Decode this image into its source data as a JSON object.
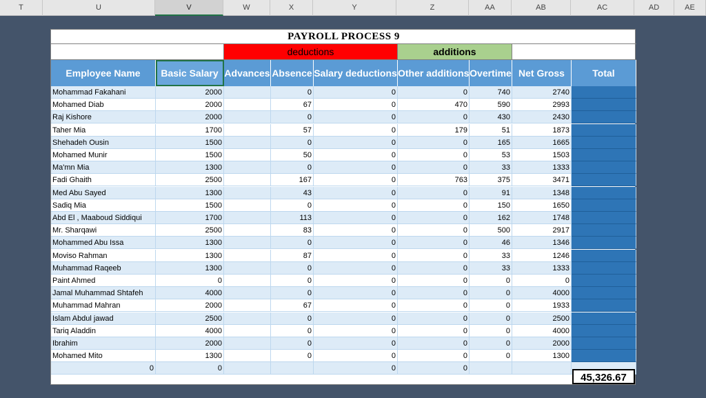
{
  "column_headers": [
    "T",
    "U",
    "V",
    "W",
    "X",
    "Y",
    "Z",
    "AA",
    "AB",
    "AC",
    "AD",
    "AE"
  ],
  "title": "PAYROLL PROCESS  9",
  "bands": {
    "deductions": "deductions",
    "additions": "additions"
  },
  "colors": {
    "deductions_band": "#ff0000",
    "additions_band": "#a9d08e",
    "header_fill": "#5b9bd5",
    "total_fill": "#2e75b6",
    "zebra": "#ddebf7",
    "background": "#44546a"
  },
  "headers": [
    "Employee Name",
    "Basic Salary",
    "Advances",
    "Absence",
    "Salary deductions",
    "Other additions",
    "Overtime",
    "Net Gross",
    "Total"
  ],
  "rows": [
    [
      "Mohammad Fakahani",
      "2000",
      "",
      "0",
      "0",
      "0",
      "740",
      "2740"
    ],
    [
      "Mohamed Diab",
      "2000",
      "",
      "67",
      "0",
      "470",
      "590",
      "2993"
    ],
    [
      "Raj Kishore",
      "2000",
      "",
      "0",
      "0",
      "0",
      "430",
      "2430"
    ],
    [
      "Taher Mia",
      "1700",
      "",
      "57",
      "0",
      "179",
      "51",
      "1873"
    ],
    [
      "Shehadeh Ousin",
      "1500",
      "",
      "0",
      "0",
      "0",
      "165",
      "1665"
    ],
    [
      "Mohamed Munir",
      "1500",
      "",
      "50",
      "0",
      "0",
      "53",
      "1503"
    ],
    [
      "Ma'mn Mia",
      "1300",
      "",
      "0",
      "0",
      "0",
      "33",
      "1333"
    ],
    [
      "Fadi Ghaith",
      "2500",
      "",
      "167",
      "0",
      "763",
      "375",
      "3471"
    ],
    [
      "Med Abu Sayed",
      "1300",
      "",
      "43",
      "0",
      "0",
      "91",
      "1348"
    ],
    [
      "Sadiq Mia",
      "1500",
      "",
      "0",
      "0",
      "0",
      "150",
      "1650"
    ],
    [
      "Abd El , Maaboud Siddiqui",
      "1700",
      "",
      "113",
      "0",
      "0",
      "162",
      "1748"
    ],
    [
      "Mr. Sharqawi",
      "2500",
      "",
      "83",
      "0",
      "0",
      "500",
      "2917"
    ],
    [
      "Mohammed Abu Issa",
      "1300",
      "",
      "0",
      "0",
      "0",
      "46",
      "1346"
    ],
    [
      "Moviso Rahman",
      "1300",
      "",
      "87",
      "0",
      "0",
      "33",
      "1246"
    ],
    [
      "Muhammad Raqeeb",
      "1300",
      "",
      "0",
      "0",
      "0",
      "33",
      "1333"
    ],
    [
      "Paint Ahmed",
      "0",
      "",
      "0",
      "0",
      "0",
      "0",
      "0"
    ],
    [
      "Jamal Muhammad Shtafeh",
      "4000",
      "",
      "0",
      "0",
      "0",
      "0",
      "4000"
    ],
    [
      "Muhammad Mahran",
      "2000",
      "",
      "67",
      "0",
      "0",
      "0",
      "1933"
    ],
    [
      "Islam Abdul jawad",
      "2500",
      "",
      "0",
      "0",
      "0",
      "0",
      "2500"
    ],
    [
      "Tariq Aladdin",
      "4000",
      "",
      "0",
      "0",
      "0",
      "0",
      "4000"
    ],
    [
      "Ibrahim",
      "2000",
      "",
      "0",
      "0",
      "0",
      "0",
      "2000"
    ],
    [
      "Mohamed Mito",
      "1300",
      "",
      "0",
      "0",
      "0",
      "0",
      "1300"
    ]
  ],
  "totals_row": [
    "0",
    "0",
    "",
    "",
    "0",
    "0",
    "",
    ""
  ],
  "grand_total": "45,326.67"
}
